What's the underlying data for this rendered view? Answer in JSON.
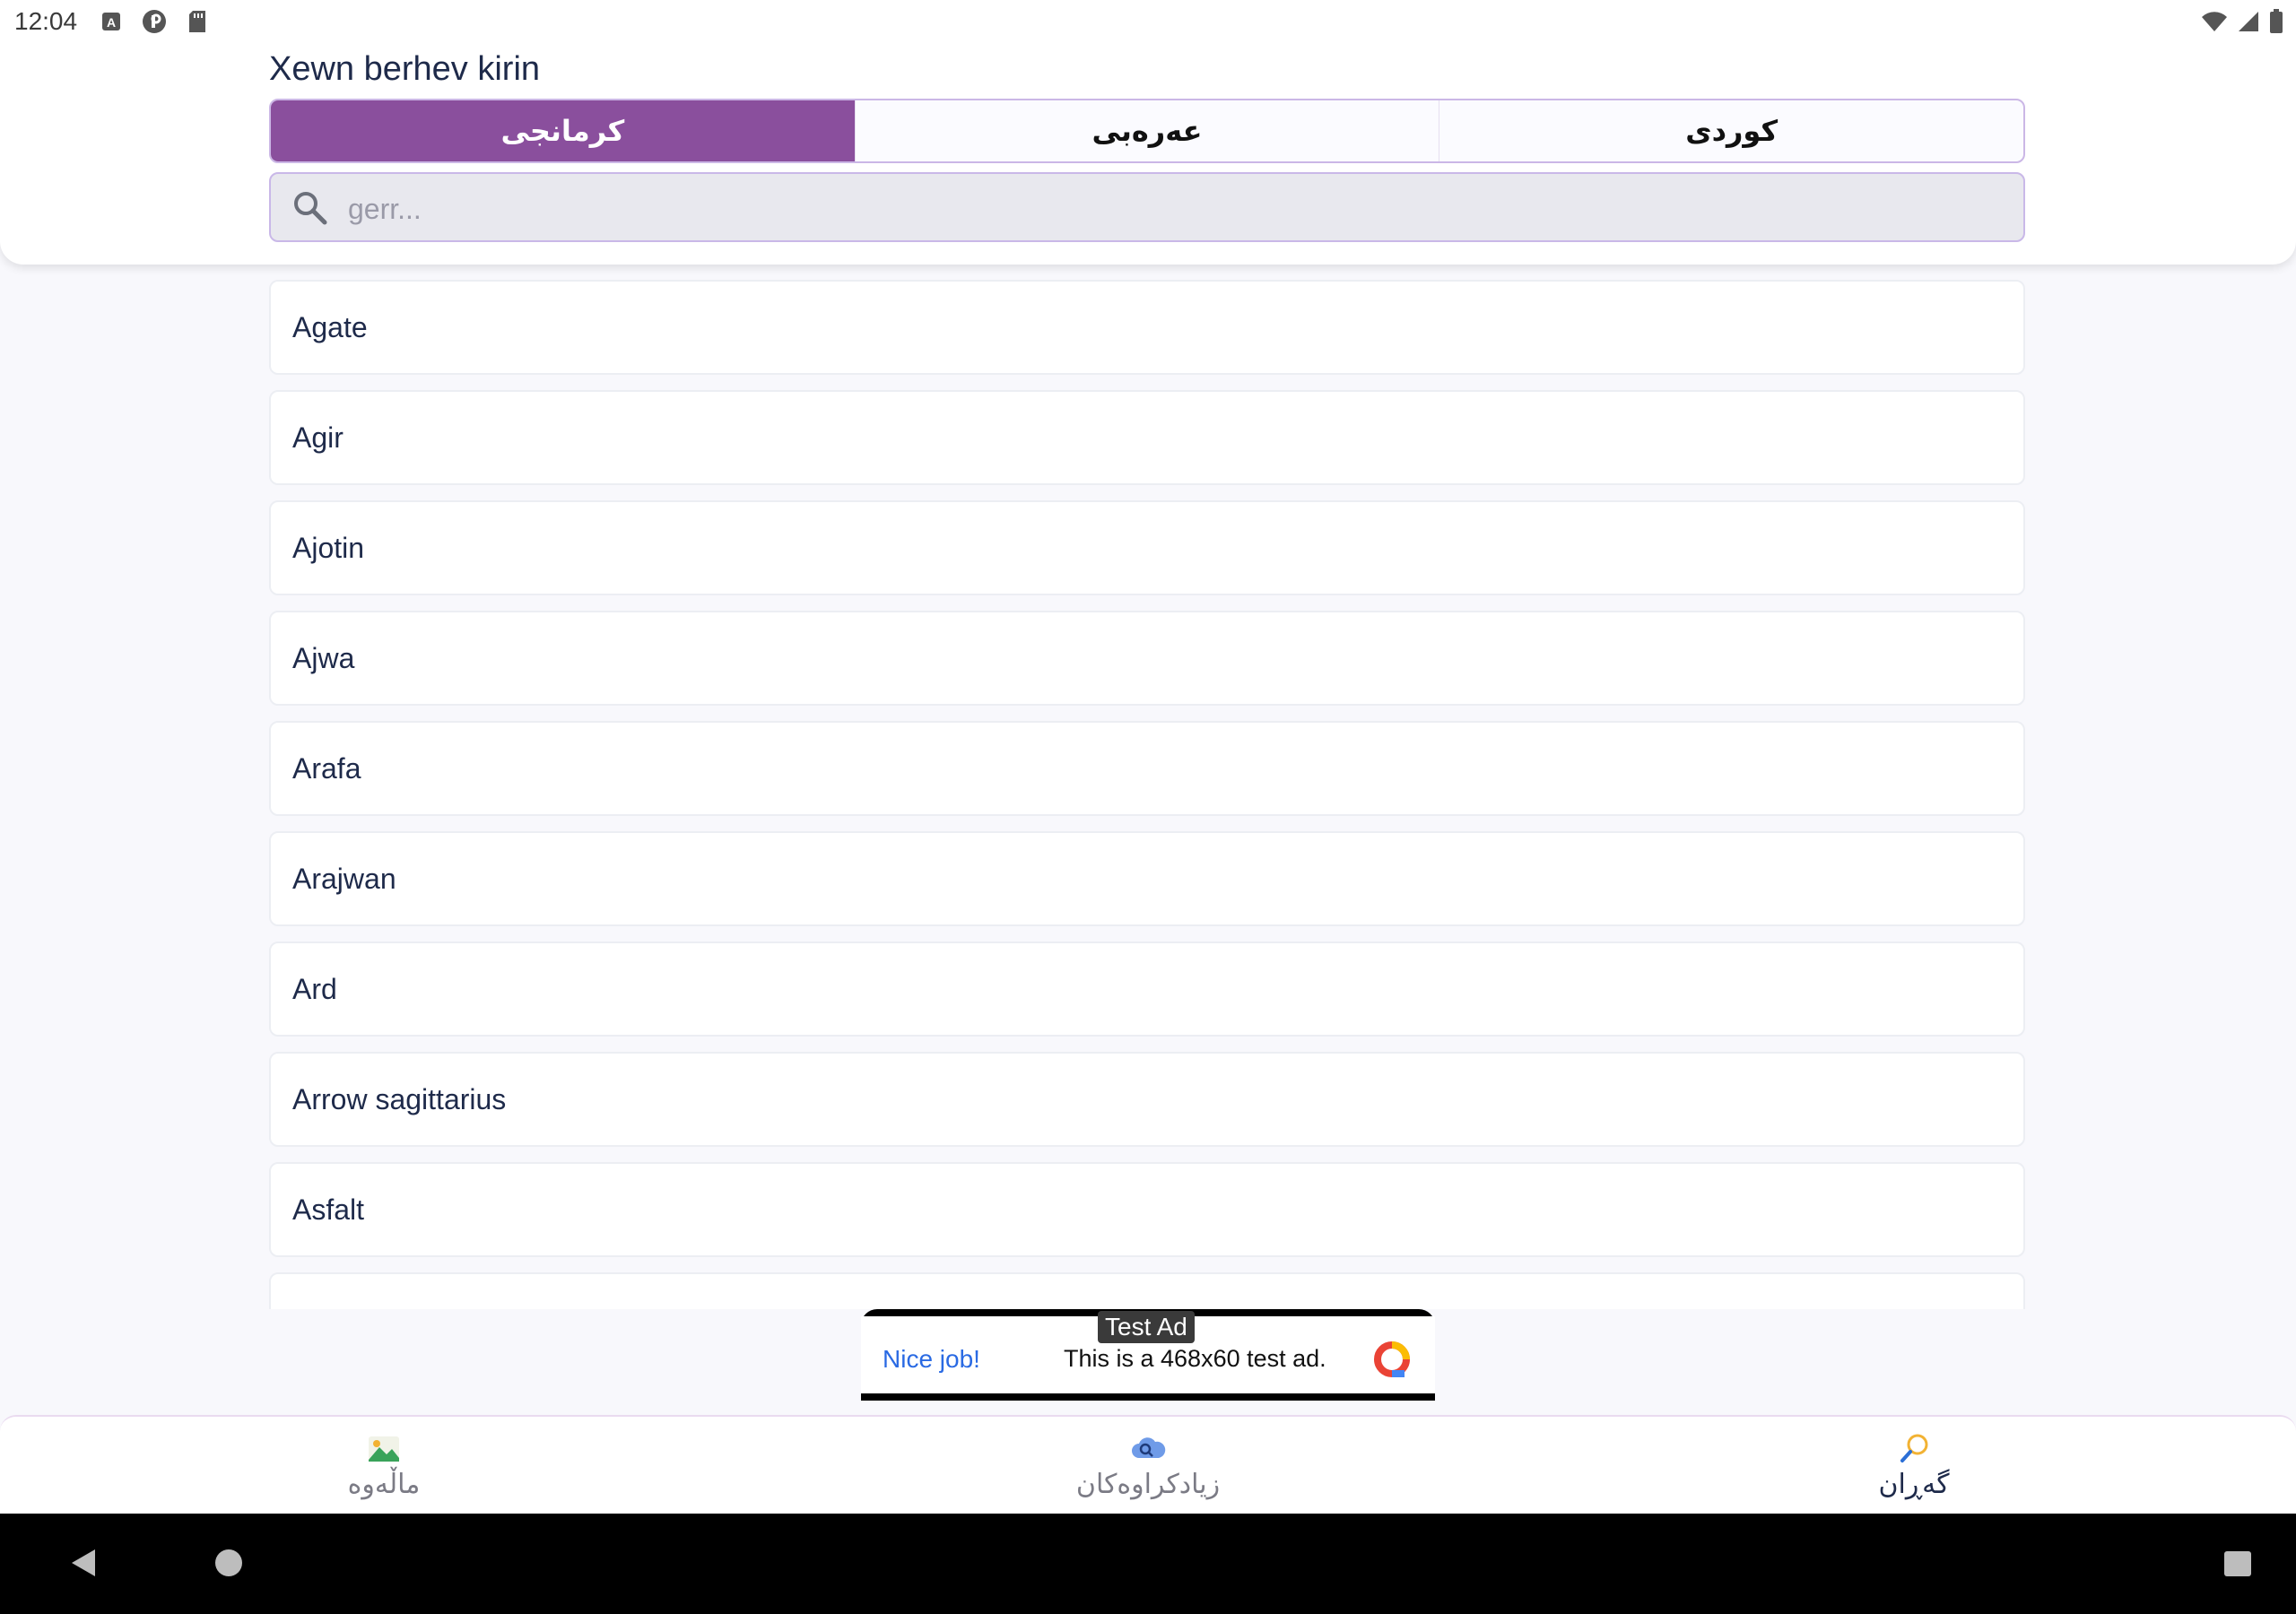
{
  "status_bar": {
    "time": "12:04"
  },
  "header": {
    "title": "Xewn berhev kirin"
  },
  "tabs": [
    {
      "label": "کرمانجی",
      "active": true
    },
    {
      "label": "عەرەبی",
      "active": false
    },
    {
      "label": "کوردی",
      "active": false
    }
  ],
  "search": {
    "placeholder": "gerr...",
    "value": ""
  },
  "list": {
    "items": [
      "Agate",
      "Agir",
      "Ajotin",
      "Ajwa",
      "Arafa",
      "Arajwan",
      "Ard",
      "Arrow sagittarius",
      "Asfalt"
    ]
  },
  "ad": {
    "badge": "Test Ad",
    "headline": "Nice job!",
    "body": "This is a 468x60 test ad."
  },
  "bottom_nav": {
    "items": [
      {
        "label": "ماڵەوە",
        "icon": "image-landscape-icon",
        "active": false
      },
      {
        "label": "زیادکراوەکان",
        "icon": "cloud-search-icon",
        "active": false
      },
      {
        "label": "گەڕان",
        "icon": "magnifier-icon",
        "active": true
      }
    ]
  },
  "colors": {
    "accent": "#8a4f9d",
    "text": "#1e2a4a",
    "ad_link": "#2a6ae3"
  }
}
